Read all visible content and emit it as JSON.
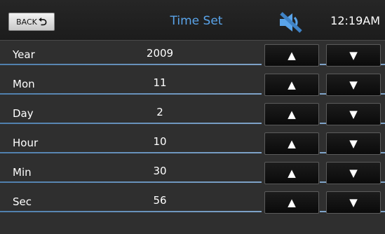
{
  "header": {
    "back_label": "BACK",
    "back_icon": "return-arrow-icon",
    "title": "Time Set",
    "status_icon": "speaker-muted-icon",
    "clock": "12:19AM"
  },
  "rows": [
    {
      "label": "Year",
      "value": "2009"
    },
    {
      "label": "Mon",
      "value": "11"
    },
    {
      "label": "Day",
      "value": "2"
    },
    {
      "label": "Hour",
      "value": "10"
    },
    {
      "label": "Min",
      "value": "30"
    },
    {
      "label": "Sec",
      "value": "56"
    }
  ],
  "controls": {
    "up_glyph": "▲",
    "down_glyph": "▼"
  },
  "colors": {
    "accent": "#5aa4ea",
    "background": "#2f2f2f",
    "divider": "#7fa3c8",
    "button": "#111111"
  }
}
